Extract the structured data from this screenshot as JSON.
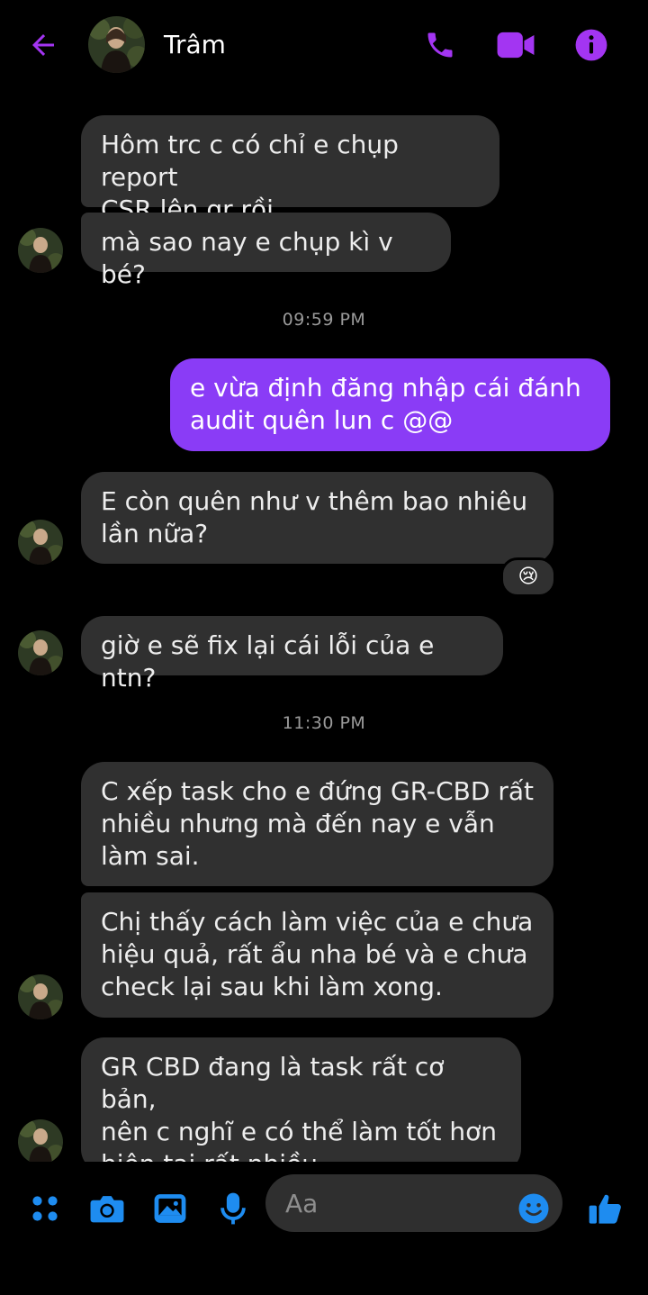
{
  "header": {
    "contact_name": "Trâm",
    "back_icon": "back-arrow-icon",
    "call_icon": "phone-icon",
    "video_icon": "video-camera-icon",
    "info_icon": "info-icon",
    "accent_color": "#a335f2"
  },
  "messages": {
    "m1": {
      "lines": [
        "Hôm trc c có chỉ e chụp report",
        "CSR lên gr rồi"
      ]
    },
    "m2": {
      "lines": [
        "mà sao nay e chụp kì v bé?"
      ]
    },
    "ts1": "09:59 PM",
    "m3": {
      "lines": [
        "e vừa định đăng nhập cái đánh",
        "audit quên lun c @@"
      ]
    },
    "m4": {
      "lines": [
        "E còn quên như v thêm bao nhiêu",
        "lần nữa?"
      ],
      "reaction": "😢"
    },
    "m5": {
      "lines": [
        "giờ e sẽ fix lại cái lỗi của e ntn?"
      ]
    },
    "ts2": "11:30 PM",
    "m6": {
      "lines": [
        "C xếp task cho e đứng GR-CBD rất",
        "nhiều nhưng mà đến nay e vẫn",
        "làm sai."
      ]
    },
    "m7": {
      "lines": [
        "Chị thấy cách làm việc của e chưa",
        "hiệu quả, rất ẩu nha bé và e chưa",
        "check lại sau khi làm xong."
      ]
    },
    "m8": {
      "lines": [
        "GR CBD đang là task rất cơ bản,",
        "nên c nghĩ e có thể làm tốt hơn",
        "hiện tại rất nhiều."
      ]
    }
  },
  "composer": {
    "placeholder": "Aa",
    "menu_icon": "four-dots-menu-icon",
    "camera_icon": "camera-icon",
    "gallery_icon": "image-gallery-icon",
    "mic_icon": "microphone-icon",
    "emoji_icon": "emoji-smile-icon",
    "like_icon": "thumbs-up-icon",
    "accent_color": "#1e8cf0"
  },
  "colors": {
    "received_bubble": "#303030",
    "sent_bubble": "#8a3cf6",
    "background": "#000000"
  }
}
